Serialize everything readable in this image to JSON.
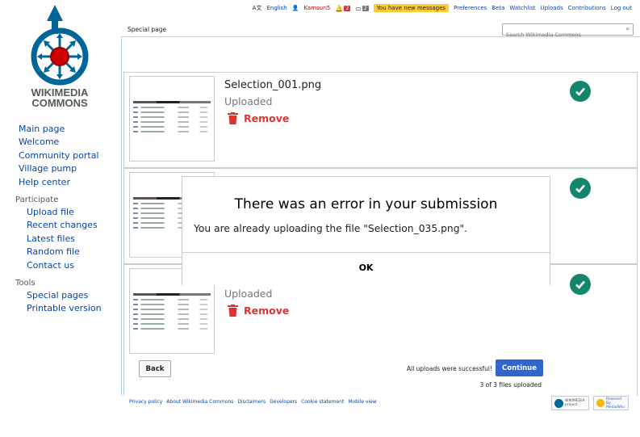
{
  "personal": {
    "language": "English",
    "username": "Kamsuri5",
    "alerts_count": "2",
    "notices_count": "2",
    "messages": "You have new messages",
    "links": [
      "Preferences",
      "Beta",
      "Watchlist",
      "Uploads",
      "Contributions",
      "Log out"
    ]
  },
  "logo": {
    "line1": "WIKIMEDIA",
    "line2": "COMMONS"
  },
  "sidebar": {
    "main": [
      "Main page",
      "Welcome",
      "Community portal",
      "Village pump",
      "Help center"
    ],
    "participate_heading": "Participate",
    "participate": [
      "Upload file",
      "Recent changes",
      "Latest files",
      "Random file",
      "Contact us"
    ],
    "tools_heading": "Tools",
    "tools": [
      "Special pages",
      "Printable version"
    ]
  },
  "tabs": {
    "special": "Special page"
  },
  "search": {
    "placeholder": "Search Wikimedia Commons"
  },
  "uploads": [
    {
      "name": "Selection_001.png",
      "status": "Uploaded",
      "remove": "Remove"
    },
    {
      "name": "",
      "status": "",
      "remove": ""
    },
    {
      "name": "",
      "status": "Uploaded",
      "remove": "Remove"
    }
  ],
  "dialog": {
    "title": "There was an error in your submission",
    "body": "You are already uploading the file \"Selection_035.png\".",
    "ok": "OK"
  },
  "bottom": {
    "back": "Back",
    "success": "All uploads were successful!",
    "continue": "Continue",
    "count": "3 of 3 files uploaded"
  },
  "footer": {
    "links": [
      "Privacy policy",
      "About Wikimedia Commons",
      "Disclaimers",
      "Developers",
      "Cookie statement",
      "Mobile view"
    ],
    "wikimedia_badge": "WIKIMEDIA project",
    "mediawiki_badge": "Powered By MediaWiki"
  },
  "colors": {
    "accent": "#3366cc",
    "success": "#14866d",
    "destructive": "#dd3333",
    "link": "#0645ad",
    "message_bg": "#ffcc33"
  }
}
